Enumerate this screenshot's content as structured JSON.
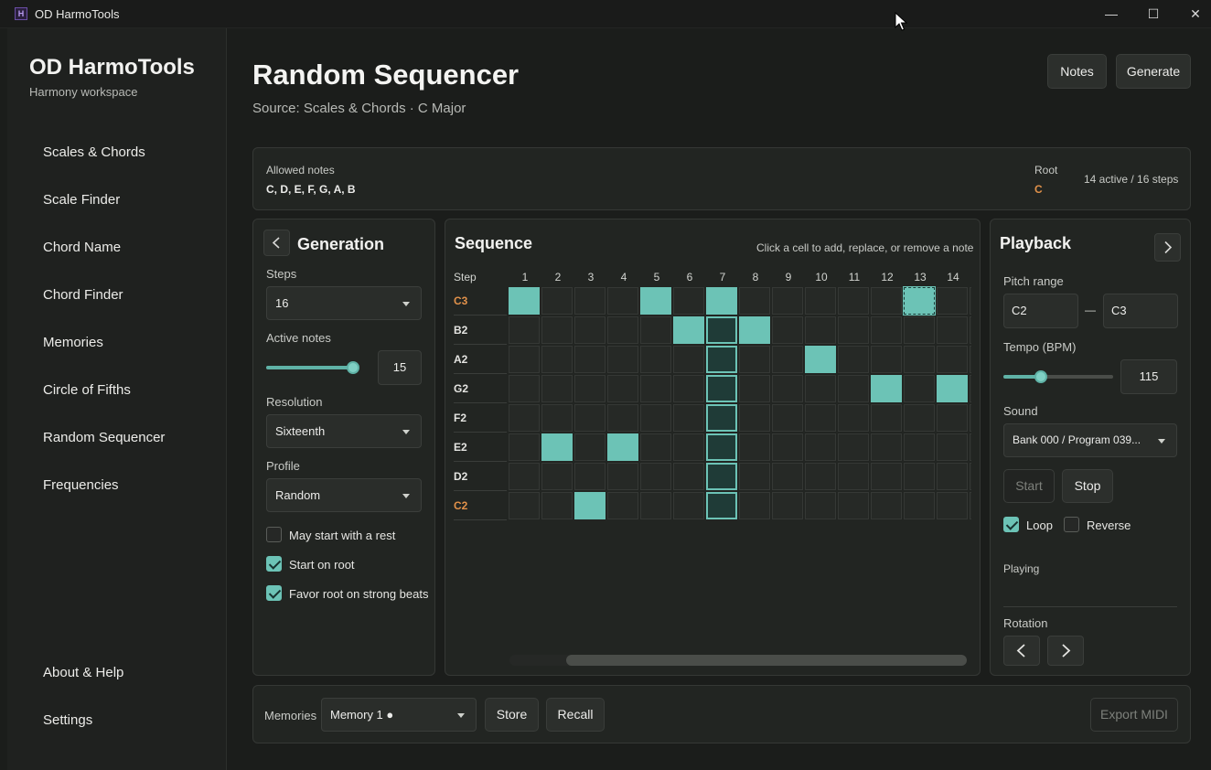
{
  "window": {
    "title": "OD HarmoTools",
    "minimize": "—",
    "maximize": "☐",
    "close": "✕"
  },
  "sidebar": {
    "title": "OD HarmoTools",
    "subtitle": "Harmony workspace",
    "items": [
      "Scales & Chords",
      "Scale Finder",
      "Chord Name",
      "Chord Finder",
      "Memories",
      "Circle of Fifths",
      "Random Sequencer",
      "Frequencies"
    ],
    "bottom_items": [
      "About & Help",
      "Settings"
    ]
  },
  "header": {
    "title": "Random Sequencer",
    "subtitle": "Source: Scales & Chords · C Major",
    "notes_button": "Notes",
    "generate_button": "Generate"
  },
  "info": {
    "allowed_label": "Allowed notes",
    "allowed_value": "C, D, E, F, G, A, B",
    "root_label": "Root",
    "root_value": "C",
    "status": "14 active / 16 steps"
  },
  "generation": {
    "title": "Generation",
    "steps_label": "Steps",
    "steps_value": "16",
    "active_label": "Active notes",
    "active_value": "15",
    "active_fraction": 0.95,
    "resolution_label": "Resolution",
    "resolution_value": "Sixteenth",
    "profile_label": "Profile",
    "profile_value": "Random",
    "options": [
      {
        "label": "May start with a rest",
        "checked": false
      },
      {
        "label": "Start on root",
        "checked": true
      },
      {
        "label": "Favor root on strong beats",
        "checked": true
      }
    ]
  },
  "sequence": {
    "title": "Sequence",
    "hint": "Click a cell to add, replace, or remove a note",
    "step_label": "Step",
    "columns": [
      "1",
      "2",
      "3",
      "4",
      "5",
      "6",
      "7",
      "8",
      "9",
      "10",
      "11",
      "12",
      "13",
      "14"
    ],
    "rows": [
      {
        "note": "C3",
        "root": true,
        "on": [
          1,
          5,
          7
        ],
        "selected": [
          13
        ]
      },
      {
        "note": "B2",
        "root": false,
        "on": [
          6,
          8
        ],
        "selected": []
      },
      {
        "note": "A2",
        "root": false,
        "on": [
          10
        ],
        "selected": []
      },
      {
        "note": "G2",
        "root": false,
        "on": [
          12,
          14
        ],
        "selected": []
      },
      {
        "note": "F2",
        "root": false,
        "on": [],
        "selected": []
      },
      {
        "note": "E2",
        "root": false,
        "on": [
          2,
          4
        ],
        "selected": []
      },
      {
        "note": "D2",
        "root": false,
        "on": [],
        "selected": []
      },
      {
        "note": "C2",
        "root": true,
        "on": [
          3
        ],
        "selected": []
      }
    ],
    "playhead_step": 7
  },
  "playback": {
    "title": "Playback",
    "pitch_label": "Pitch range",
    "pitch_low": "C2",
    "pitch_sep": "—",
    "pitch_high": "C3",
    "tempo_label": "Tempo (BPM)",
    "tempo_value": "115",
    "tempo_fraction": 0.34,
    "sound_label": "Sound",
    "sound_value": "Bank 000 / Program 039...",
    "start_button": "Start",
    "stop_button": "Stop",
    "loop_label": "Loop",
    "loop_checked": true,
    "reverse_label": "Reverse",
    "reverse_checked": false,
    "status": "Playing",
    "rotation_label": "Rotation"
  },
  "footer": {
    "memories_label": "Memories",
    "memory_value": "Memory 1 ●",
    "store_button": "Store",
    "recall_button": "Recall",
    "export_button": "Export MIDI"
  },
  "colors": {
    "accent": "#6cc3b6",
    "root": "#e1914a",
    "background": "#1b1d1b"
  }
}
